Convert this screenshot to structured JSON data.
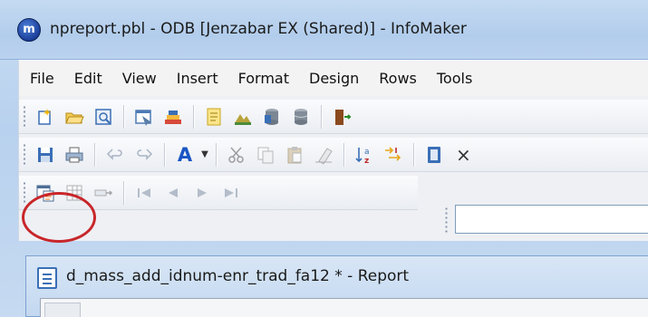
{
  "window": {
    "title": "npreport.pbl - ODB [Jenzabar EX (Shared)]  - InfoMaker"
  },
  "menu": [
    "File",
    "Edit",
    "View",
    "Insert",
    "Format",
    "Design",
    "Rows",
    "Tools"
  ],
  "toolbar1": {
    "icons": [
      "new-icon",
      "open-icon",
      "preview-icon",
      "datawindow-icon",
      "library-icon",
      "notepad-icon",
      "database-icon",
      "db-profile-icon",
      "db-painter-icon",
      "exit-icon"
    ]
  },
  "toolbar2": {
    "icons": [
      "save-icon",
      "print-icon",
      "undo-icon",
      "redo-icon",
      "font-color-icon",
      "cut-icon",
      "copy-icon",
      "paste-icon",
      "clear-icon",
      "sort-icon",
      "filter-icon",
      "properties-icon",
      "close-icon"
    ],
    "font_glyph": "A",
    "close_glyph": "×"
  },
  "toolbar3": {
    "icons": [
      "report-preview-icon",
      "grid-icon",
      "retrieve-icon",
      "first-page-icon",
      "prior-page-icon",
      "next-page-icon",
      "last-page-icon"
    ]
  },
  "child_window": {
    "title": "d_mass_add_idnum-enr_trad_fa12 * - Report"
  },
  "colors": {
    "highlight_ring": "#c8262a",
    "accent_blue": "#1a55c4"
  }
}
